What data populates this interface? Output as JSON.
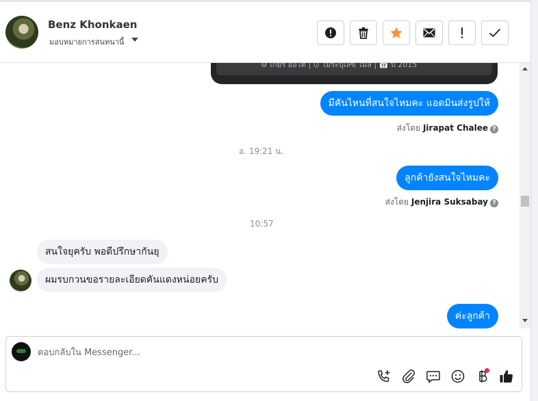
{
  "header": {
    "contact_name": "Benz Khonkaen",
    "assignee_label": "มอบหมายการสนทนานี้",
    "actions": [
      {
        "name": "report-spam-button",
        "icon": "alert-circle-icon"
      },
      {
        "name": "delete-button",
        "icon": "trash-icon"
      },
      {
        "name": "star-button",
        "icon": "star-icon"
      },
      {
        "name": "mark-unread-button",
        "icon": "envelope-icon"
      },
      {
        "name": "follow-up-button",
        "icon": "exclamation-icon"
      },
      {
        "name": "mark-done-button",
        "icon": "check-icon"
      }
    ],
    "star_color": "#f7923b"
  },
  "card": {
    "partial_text": "⚙ เกียร์ ออโต้   |   ⊙ ไม่ระบุเลข ไมล์   |   📅 ปี 2015"
  },
  "messages": {
    "out_1": {
      "text": "มีคันไหนที่สนใจไหมคะ แอดมินส่งรูปให้",
      "sent_by_prefix": "ส่งโดย",
      "sender": "Jirapat Chalee",
      "help": "?"
    },
    "time_1": "อ. 19:21 น.",
    "out_2": {
      "text": "ลูกค้ายังสนใจไหมคะ",
      "sent_by_prefix": "ส่งโดย",
      "sender": "Jenjira Suksabay",
      "help": "?"
    },
    "time_2": "10:57",
    "in_1": {
      "text": "สนใจยุครับ พอดีปรึกษากันยุ"
    },
    "in_2": {
      "text": "ผมรบกวนขอรายละเอียดคันแดงหน่อยครับ"
    },
    "out_3": {
      "text": "ค่ะลูกค้า"
    }
  },
  "composer": {
    "placeholder": "ตอบกลับใน Messenger...",
    "tools": [
      "add-call-icon",
      "paperclip-icon",
      "saved-replies-icon",
      "emoji-icon",
      "baht-icon",
      "like-icon"
    ]
  },
  "colors": {
    "accent": "#0084ff",
    "notify_dot": "#f02849"
  }
}
